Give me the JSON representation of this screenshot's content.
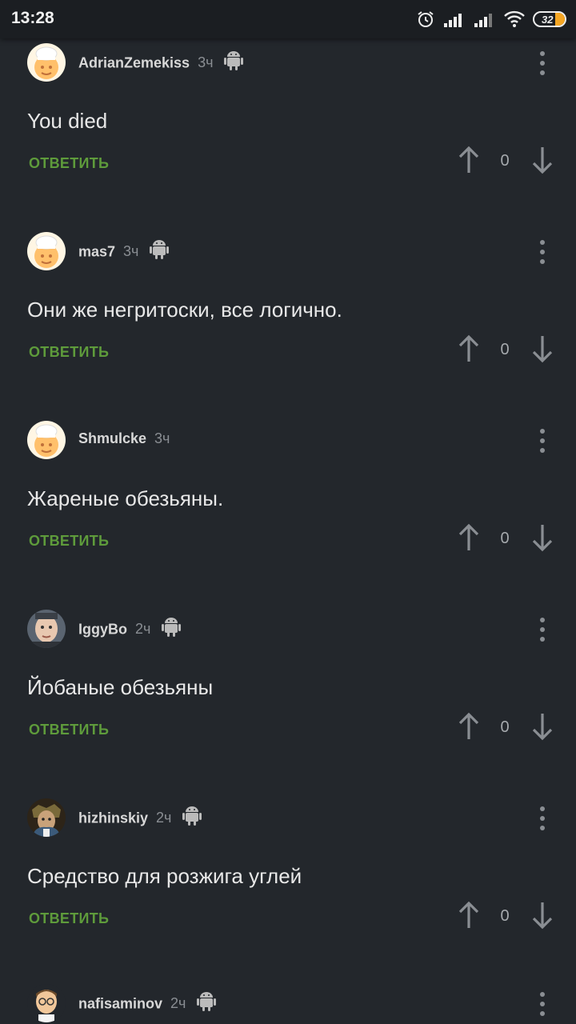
{
  "status_bar": {
    "time": "13:28",
    "battery": "32"
  },
  "comments": [
    {
      "username": "AdrianZemekiss",
      "time": "3ч",
      "text": "You died",
      "reply_label": "ОТВЕТИТЬ",
      "score": "0",
      "avatar": "chef-avatar",
      "platform_icon": "android-icon"
    },
    {
      "username": "mas7",
      "time": "3ч",
      "text": "Они же негритоски, все логично.",
      "reply_label": "ОТВЕТИТЬ",
      "score": "0",
      "avatar": "chef-avatar",
      "platform_icon": "android-icon"
    },
    {
      "username": "Shmulcke",
      "time": "3ч",
      "text": "Жареные обезьяны.",
      "reply_label": "ОТВЕТИТЬ",
      "score": "0",
      "avatar": "chef-avatar",
      "platform_icon": null
    },
    {
      "username": "IggyBo",
      "time": "2ч",
      "text": "Йобаные обезьяны",
      "reply_label": "ОТВЕТИТЬ",
      "score": "0",
      "avatar": "photo-avatar",
      "platform_icon": "android-icon"
    },
    {
      "username": "hizhinskiy",
      "time": "2ч",
      "text": "Средство для розжига углей",
      "reply_label": "ОТВЕТИТЬ",
      "score": "0",
      "avatar": "painting-avatar",
      "platform_icon": "android-icon"
    },
    {
      "username": "nafisaminov",
      "time": "2ч",
      "text": "",
      "reply_label": "",
      "score": "",
      "avatar": "cartoon-avatar",
      "platform_icon": "android-icon"
    }
  ],
  "colors": {
    "background": "#23272c",
    "reply": "#5e9b3b",
    "status_bar": "#1b1e22"
  }
}
